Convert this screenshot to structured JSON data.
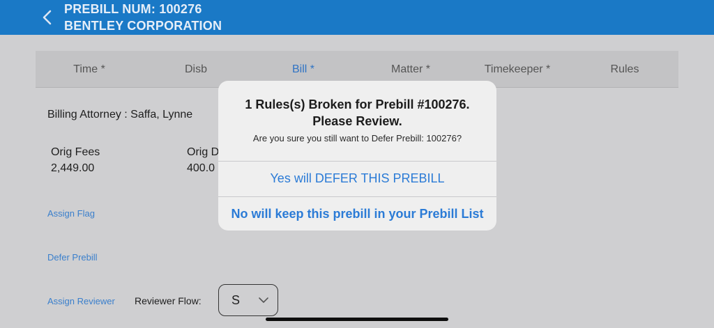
{
  "header": {
    "title_line1": "PREBILL NUM: 100276",
    "title_line2": "BENTLEY CORPORATION",
    "back_icon": "chevron-left-icon",
    "color": "#1a79c6"
  },
  "tabs": [
    {
      "label": "Time *"
    },
    {
      "label": "Disb"
    },
    {
      "label": "Bill *",
      "active": true
    },
    {
      "label": "Matter *"
    },
    {
      "label": "Timekeeper *"
    },
    {
      "label": "Rules"
    }
  ],
  "billing_attorney": "Billing Attorney : Saffa, Lynne",
  "fees": {
    "orig_fees_label": "Orig Fees",
    "orig_fees_value": "2,449.00",
    "orig_d_label": "Orig D",
    "orig_d_value": "400.0"
  },
  "actions": {
    "assign_flag": "Assign Flag",
    "defer_prebill": "Defer Prebill",
    "assign_reviewer": "Assign Reviewer"
  },
  "reviewer_flow": {
    "label": "Reviewer Flow:",
    "value": "S"
  },
  "dialog": {
    "title_line1": "1 Rules(s) Broken for Prebill #100276.",
    "title_line2": "Please Review.",
    "message": "Are you sure you still want to Defer Prebill: 100276?",
    "yes_label": "Yes will DEFER THIS PREBILL",
    "no_label": "No will keep this prebill in your Prebill List"
  },
  "colors": {
    "accent": "#2b7bd6",
    "link": "#3a7fcc",
    "backdrop": "#cfcfd1"
  }
}
